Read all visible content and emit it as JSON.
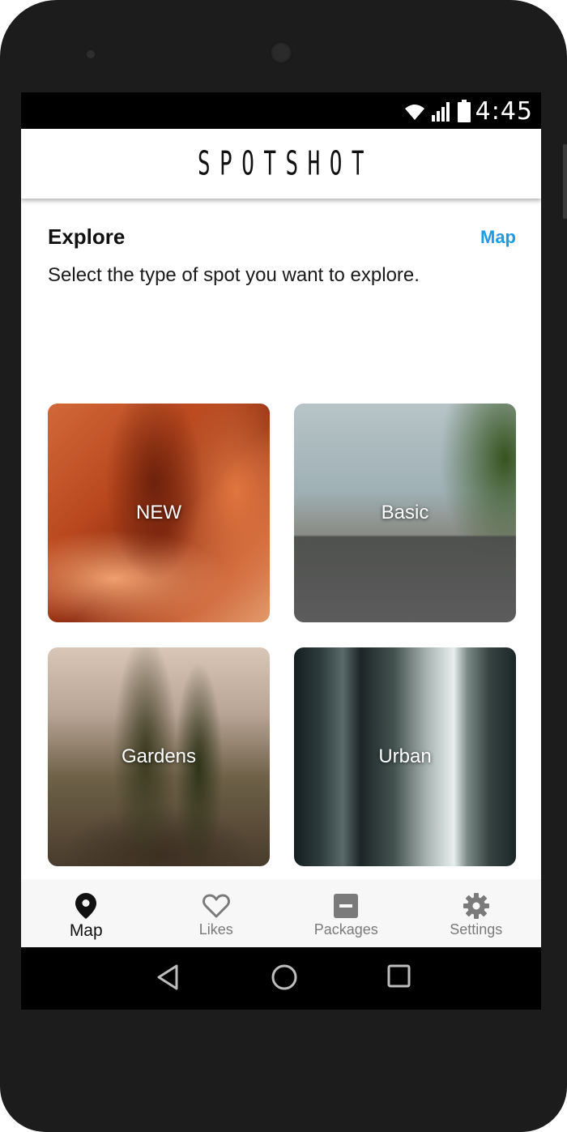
{
  "status_bar": {
    "time": "4:45"
  },
  "header": {
    "logo": "SPOTSHOT"
  },
  "explore": {
    "title": "Explore",
    "map_link": "Map",
    "subtitle": "Select the type of spot you want to explore."
  },
  "tiles": [
    {
      "label": "NEW"
    },
    {
      "label": "Basic"
    },
    {
      "label": "Gardens"
    },
    {
      "label": "Urban"
    },
    {
      "label": ""
    },
    {
      "label": ""
    }
  ],
  "bottom_nav": {
    "items": [
      {
        "label": "Map",
        "icon": "map-pin-icon",
        "active": true
      },
      {
        "label": "Likes",
        "icon": "heart-icon",
        "active": false
      },
      {
        "label": "Packages",
        "icon": "package-icon",
        "active": false
      },
      {
        "label": "Settings",
        "icon": "gear-icon",
        "active": false
      }
    ]
  },
  "colors": {
    "accent": "#1e9be6",
    "active_nav": "#111111",
    "inactive_nav": "#7a7a7a"
  }
}
